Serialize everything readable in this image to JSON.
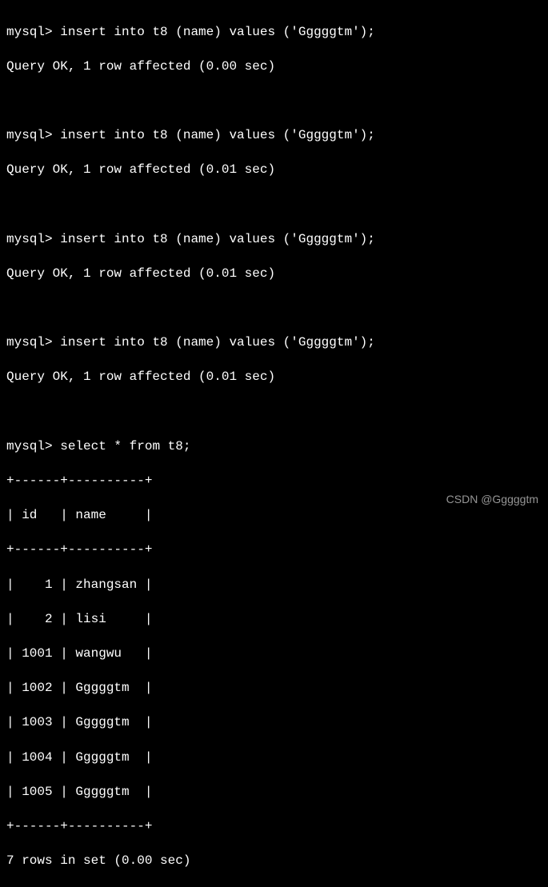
{
  "commands": [
    {
      "prompt": "mysql> ",
      "command": "insert into t8 (name) values ('Gggggtm');",
      "result": "Query OK, 1 row affected (0.00 sec)"
    },
    {
      "prompt": "mysql> ",
      "command": "insert into t8 (name) values ('Gggggtm');",
      "result": "Query OK, 1 row affected (0.01 sec)"
    },
    {
      "prompt": "mysql> ",
      "command": "insert into t8 (name) values ('Gggggtm');",
      "result": "Query OK, 1 row affected (0.01 sec)"
    },
    {
      "prompt": "mysql> ",
      "command": "insert into t8 (name) values ('Gggggtm');",
      "result": "Query OK, 1 row affected (0.01 sec)"
    }
  ],
  "select": {
    "prompt": "mysql> ",
    "command": "select * from t8;"
  },
  "table": {
    "border_top": "+------+----------+",
    "header": "| id   | name     |",
    "border_mid": "+------+----------+",
    "rows": [
      "|    1 | zhangsan |",
      "|    2 | lisi     |",
      "| 1001 | wangwu   |",
      "| 1002 | Gggggtm  |",
      "| 1003 | Gggggtm  |",
      "| 1004 | Gggggtm  |",
      "| 1005 | Gggggtm  |"
    ],
    "border_bot": "+------+----------+",
    "footer": "7 rows in set (0.00 sec)"
  },
  "watermark": "CSDN @Gggggtm"
}
